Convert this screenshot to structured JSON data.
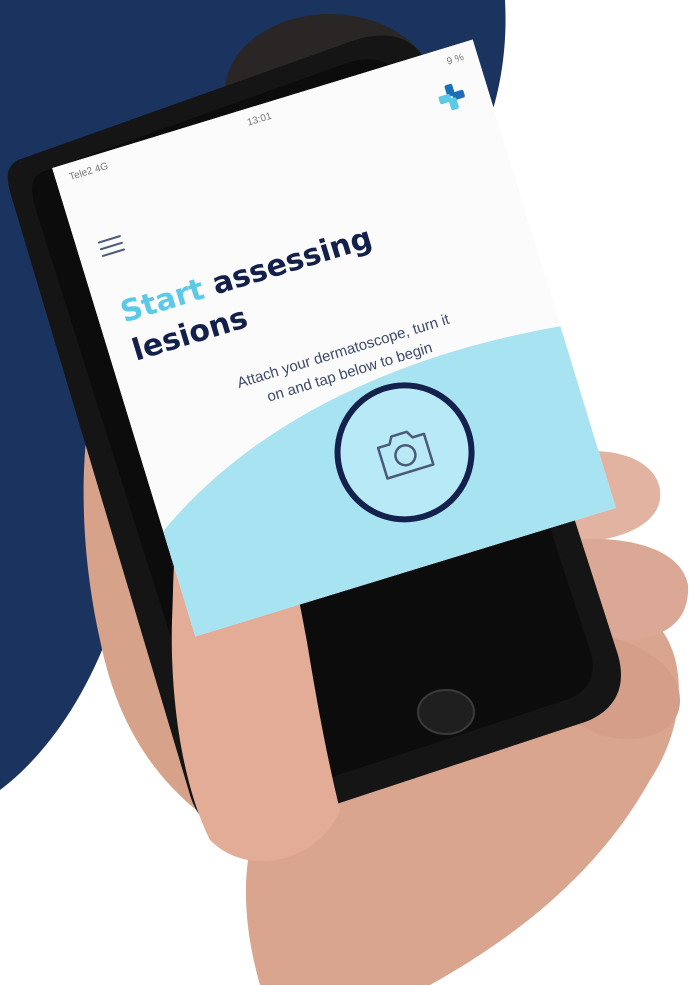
{
  "status_bar": {
    "carrier": "Tele2 4G",
    "time": "13:01",
    "battery": "9 %"
  },
  "screen": {
    "headline_accent": "Start",
    "headline_rest": "assessing",
    "headline_line2": "lesions",
    "subtext_line1": "Attach your dermatoscope, turn it",
    "subtext_line2": "on and tap below to begin"
  },
  "colors": {
    "background_navy": "#1b335f",
    "accent_cyan": "#5cc9e6",
    "wave_cyan": "#a8e3f2",
    "headline_navy": "#13204a"
  },
  "icons": {
    "menu": "hamburger-menu-icon",
    "logo": "brand-cross-logo-icon",
    "camera": "camera-icon"
  }
}
